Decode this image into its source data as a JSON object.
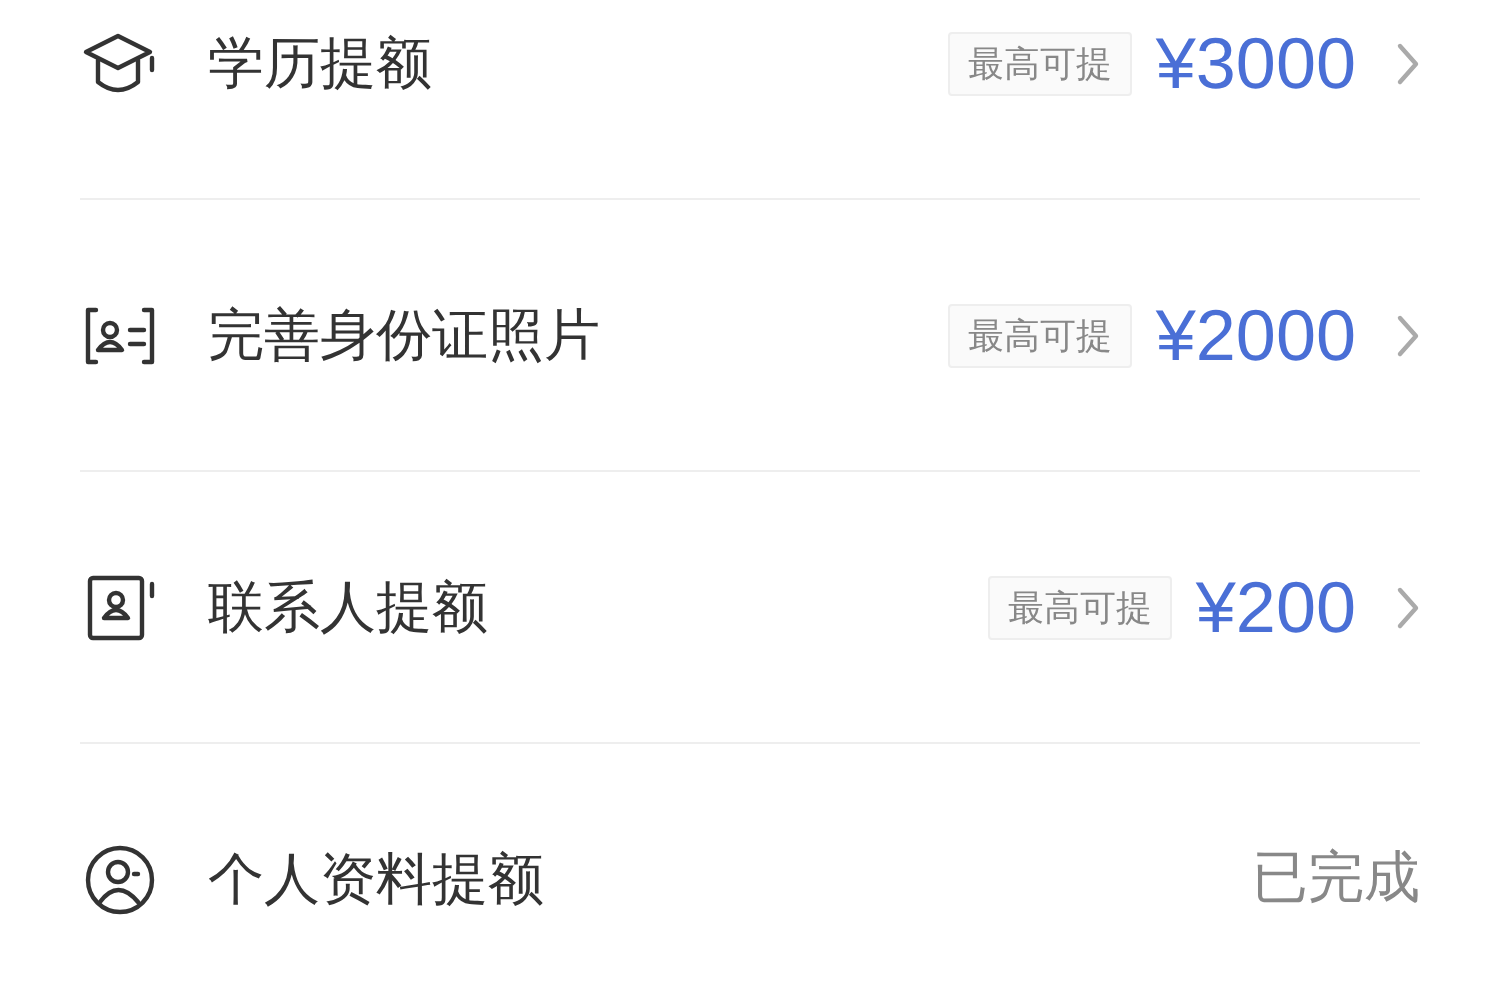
{
  "items": [
    {
      "kind": "limit",
      "label": "学历提额",
      "badge": "最高可提",
      "amount": "¥3000"
    },
    {
      "kind": "limit",
      "label": "完善身份证照片",
      "badge": "最高可提",
      "amount": "¥2000"
    },
    {
      "kind": "limit",
      "label": "联系人提额",
      "badge": "最高可提",
      "amount": "¥200"
    },
    {
      "kind": "done",
      "label": "个人资料提额",
      "status": "已完成"
    }
  ]
}
